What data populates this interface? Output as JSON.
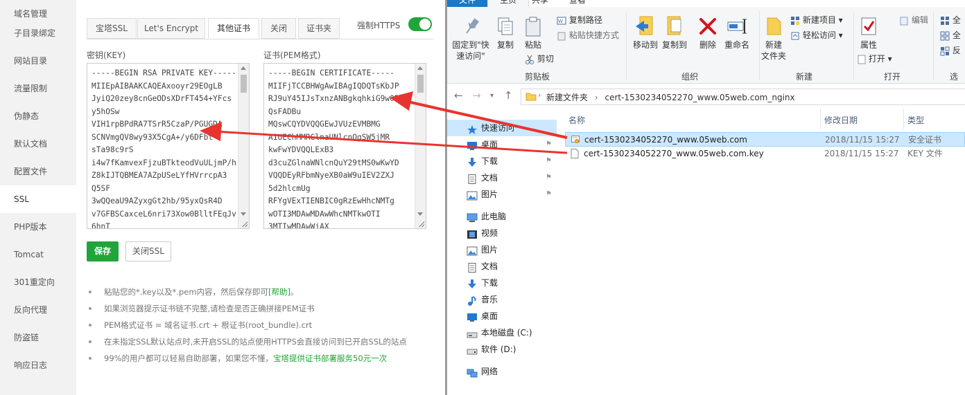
{
  "left_panel": {
    "sidebar": {
      "items": [
        {
          "label": "域名管理",
          "active": false
        },
        {
          "label": "子目录绑定",
          "active": false
        },
        {
          "label": "网站目录",
          "active": false
        },
        {
          "label": "流量限制",
          "active": false
        },
        {
          "label": "伪静态",
          "active": false
        },
        {
          "label": "默认文档",
          "active": false
        },
        {
          "label": "配置文件",
          "active": false
        },
        {
          "label": "SSL",
          "active": true
        },
        {
          "label": "PHP版本",
          "active": false
        },
        {
          "label": "Tomcat",
          "active": false
        },
        {
          "label": "301重定向",
          "active": false
        },
        {
          "label": "反向代理",
          "active": false
        },
        {
          "label": "防盗链",
          "active": false
        },
        {
          "label": "响应日志",
          "active": false
        }
      ]
    },
    "tabs": [
      {
        "label": "宝塔SSL",
        "active": false
      },
      {
        "label": "Let's Encrypt",
        "active": false
      },
      {
        "label": "其他证书",
        "active": true
      },
      {
        "label": "关闭",
        "active": false
      },
      {
        "label": "证书夹",
        "active": false
      }
    ],
    "force_https": {
      "label": "强制HTTPS",
      "on": true
    },
    "key_field": {
      "label": "密钥(KEY)",
      "lines": [
        "-----BEGIN RSA PRIVATE KEY-----",
        "MIIEpAIBAAKCAQEAxooyr29EOgLB",
        "JyiQ20zey8cnGeODsXDrFT454+YFcs",
        "y5hOSw",
        "VIH1rpBPdRA7TSrR5CzaP/PGUGDA",
        "SCNVmgQV8wy93X5CgA+/y6DFbt",
        "sTa98c9rS",
        "i4w7fKamvexFjzuBTkteodVuULjmP/h",
        "Z8kIJTQBMEA7AZpUSeLYfHVrrcpA3",
        "Q5SF",
        "3wQQeaU9AZyxgGt2hb/95yxQsR4D",
        "v7GFBSCaxceL6nri73Xow0BlltFEqJvp",
        "6hnT"
      ]
    },
    "cert_field": {
      "label": "证书(PEM格式)",
      "lines": [
        "-----BEGIN CERTIFICATE-----",
        "MIIFjTCCBHWgAwIBAgIQDQTsKbJP",
        "RJ9uY45IJsTxnzANBgkqhkiG9w0B",
        "QsFADBu",
        "MQswCQYDVQQGEwJVUzEVMBMG",
        "A1UEChMMRGlnaUNlcnQgSW5jMR",
        "kwFwYDVQQLExB3",
        "d3cuZGlnaWNlcnQuY29tMS0wKwYD",
        "VQQDEyRFbmNyeXB0aW9uIEV2ZXJ",
        "5d2hlcmUg",
        "RFYgVExTIENBIC0gRzEwHhcNMTg",
        "wOTI3MDAwMDAwWhcNMTkwOTI",
        "3MTIwMDAwWjAX"
      ]
    },
    "buttons": {
      "save": "保存",
      "close_ssl": "关闭SSL"
    },
    "tips": [
      {
        "text": "粘贴您的*.key以及*.pem内容，然后保存即可",
        "link": "[帮助]",
        "suffix": "。"
      },
      {
        "text": "如果浏览器提示证书链不完整,请检查是否正确拼接PEM证书"
      },
      {
        "text": "PEM格式证书 = 域名证书.crt + 根证书(root_bundle).crt"
      },
      {
        "text": "在未指定SSL默认站点时,未开启SSL的站点使用HTTPS会直接访问到已开启SSL的站点"
      },
      {
        "text": "99%的用户都可以轻易自助部署，如果您不懂，",
        "link": "宝塔提供证书部署服务50元一次"
      }
    ]
  },
  "explorer": {
    "ribbon_tabs": [
      "文件",
      "主页",
      "共享",
      "查看"
    ],
    "ribbon": {
      "clipboard": {
        "group": "剪贴板",
        "pin_quick": "固定到\"快速访问\"",
        "copy": "复制",
        "paste": "粘贴",
        "copy_path": "复制路径",
        "paste_shortcut": "粘贴快捷方式",
        "cut": "剪切"
      },
      "organize": {
        "group": "组织",
        "move_to": "移动到",
        "copy_to": "复制到",
        "delete": "删除",
        "rename": "重命名"
      },
      "new": {
        "group": "新建",
        "new_folder": "新建\n文件夹",
        "new_item": "新建项目",
        "easy_access": "轻松访问"
      },
      "open": {
        "group": "打开",
        "properties": "属性",
        "open": "打开",
        "edit": "编辑"
      },
      "select": {
        "group": "选",
        "select_all": "全",
        "select_none": "全",
        "invert": "反"
      }
    },
    "address": {
      "crumbs": [
        "新建文件夹",
        "cert-1530234052270_www.05web.com_nginx"
      ]
    },
    "nav": [
      {
        "label": "快速访问",
        "icon": "star-icon",
        "selected": true,
        "pinned": false
      },
      {
        "label": "桌面",
        "icon": "desktop-icon",
        "selected": false,
        "pinned": true
      },
      {
        "label": "下载",
        "icon": "download-icon",
        "selected": false,
        "pinned": true
      },
      {
        "label": "文档",
        "icon": "documents-icon",
        "selected": false,
        "pinned": true
      },
      {
        "label": "图片",
        "icon": "pictures-icon",
        "selected": false,
        "pinned": true
      },
      {
        "label": "此电脑",
        "icon": "computer-icon",
        "selected": false,
        "pinned": false
      },
      {
        "label": "视频",
        "icon": "video-icon",
        "selected": false,
        "pinned": false
      },
      {
        "label": "图片",
        "icon": "pictures-icon",
        "selected": false,
        "pinned": false
      },
      {
        "label": "文档",
        "icon": "documents-icon",
        "selected": false,
        "pinned": false
      },
      {
        "label": "下载",
        "icon": "download-icon",
        "selected": false,
        "pinned": false
      },
      {
        "label": "音乐",
        "icon": "music-icon",
        "selected": false,
        "pinned": false
      },
      {
        "label": "桌面",
        "icon": "desktop-icon",
        "selected": false,
        "pinned": false
      },
      {
        "label": "本地磁盘 (C:)",
        "icon": "drive-c-icon",
        "selected": false,
        "pinned": false
      },
      {
        "label": "软件 (D:)",
        "icon": "drive-d-icon",
        "selected": false,
        "pinned": false
      },
      {
        "label": "网络",
        "icon": "network-icon",
        "selected": false,
        "pinned": false
      }
    ],
    "columns": {
      "name": "名称",
      "date": "修改日期",
      "type": "类型"
    },
    "files": [
      {
        "name": "cert-1530234052270_www.05web.com",
        "date": "2018/11/15 15:27",
        "type": "安全证书",
        "icon": "certificate-icon",
        "selected": true
      },
      {
        "name": "cert-1530234052270_www.05web.com.key",
        "date": "2018/11/15 15:27",
        "type": "KEY 文件",
        "icon": "file-icon",
        "selected": false
      }
    ]
  },
  "colors": {
    "accent_green": "#20a53a",
    "arrow_red": "#e8342e",
    "explorer_blue": "#1979ca",
    "selection": "#cce8ff"
  }
}
